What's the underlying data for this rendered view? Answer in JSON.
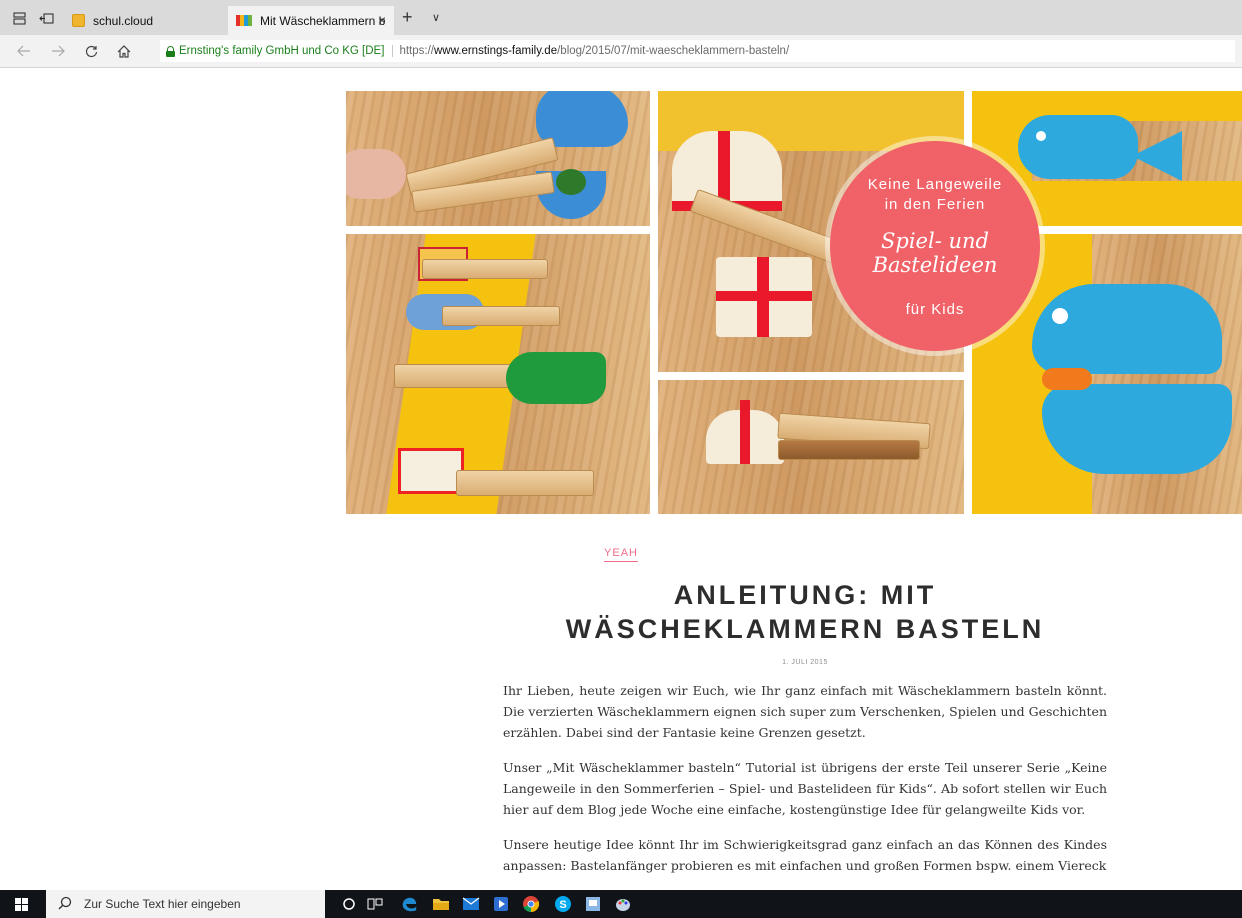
{
  "browser": {
    "tabs": [
      {
        "title": "schul.cloud",
        "active": false
      },
      {
        "title": "Mit Wäscheklammern b",
        "active": true
      }
    ],
    "new_tab_symbol": "+",
    "tab_list_symbol": "∨",
    "close_symbol": "×",
    "address": {
      "cert_owner": "Ernsting's family GmbH und Co KG [DE]",
      "url_scheme": "https://",
      "url_host": "www.ernstings-family.de",
      "url_path": "/blog/2015/07/mit-waescheklammern-basteln/"
    },
    "icons": {
      "tab_actions": "tabs-aside-icon",
      "tab_preview": "show-tabs-icon",
      "back": "back-arrow-icon",
      "forward": "forward-arrow-icon",
      "refresh": "refresh-icon",
      "home": "home-icon",
      "lock": "lock-icon"
    }
  },
  "hero_image": {
    "badge_line1": "Keine Langeweile",
    "badge_line2": "in den Ferien",
    "badge_line3": "Spiel- und Bastelideen",
    "badge_line4": "für Kids",
    "badge_color": "#f16268"
  },
  "article": {
    "category": "YEAH",
    "title_line1": "ANLEITUNG: MIT",
    "title_line2": "WÄSCHEKLAMMERN BASTELN",
    "date": "1. JULI 2015",
    "paragraphs": [
      "Ihr Lieben, heute zeigen wir Euch, wie Ihr ganz einfach mit Wäscheklammern basteln könnt. Die verzierten Wäscheklammern eignen sich super zum Verschenken, Spielen und Geschichten erzählen. Dabei sind der Fantasie keine Grenzen gesetzt.",
      "Unser „Mit Wäscheklammer basteln“ Tutorial ist übrigens der erste Teil unserer Serie „Keine Langeweile in den Sommerferien – Spiel- und Bastelideen für Kids“. Ab sofort stellen wir Euch hier auf dem Blog jede Woche eine einfache, kostengünstige Idee für gelangweilte Kids vor.",
      "Unsere heutige Idee könnt Ihr im Schwierigkeitsgrad ganz einfach an das Können des Kindes anpassen: Bastelanfänger probieren es mit einfachen und großen Formen bspw. einem Viereck"
    ],
    "accent_color": "#ef6d8a"
  },
  "taskbar": {
    "search_placeholder": "Zur Suche Text hier eingeben",
    "icons": [
      "windows-start-icon",
      "search-icon",
      "cortana-icon",
      "task-view-icon",
      "edge-icon",
      "file-explorer-icon",
      "mail-icon",
      "media-player-icon",
      "chrome-icon",
      "skype-icon",
      "notes-icon",
      "paint-icon"
    ]
  }
}
